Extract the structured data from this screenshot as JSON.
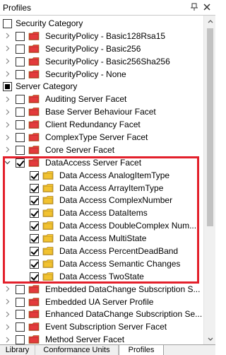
{
  "window": {
    "title": "Profiles",
    "pin_icon": "pin-icon",
    "close_icon": "close-icon"
  },
  "colors": {
    "folder_red": "#e33b3b",
    "folder_yellow": "#f2c230",
    "highlight": "#e3202b"
  },
  "tree": {
    "rows": [
      {
        "label": "Security Category",
        "level": 0,
        "check": "unchecked",
        "folder": "none",
        "arrow": "none"
      },
      {
        "label": "SecurityPolicy - Basic128Rsa15",
        "level": 1,
        "check": "unchecked",
        "folder": "red",
        "arrow": "collapsed"
      },
      {
        "label": "SecurityPolicy - Basic256",
        "level": 1,
        "check": "unchecked",
        "folder": "red",
        "arrow": "collapsed"
      },
      {
        "label": "SecurityPolicy - Basic256Sha256",
        "level": 1,
        "check": "unchecked",
        "folder": "red",
        "arrow": "collapsed"
      },
      {
        "label": "SecurityPolicy - None",
        "level": 1,
        "check": "unchecked",
        "folder": "red",
        "arrow": "collapsed"
      },
      {
        "label": "Server Category",
        "level": 0,
        "check": "partial",
        "folder": "none",
        "arrow": "none"
      },
      {
        "label": "Auditing Server Facet",
        "level": 1,
        "check": "unchecked",
        "folder": "red",
        "arrow": "collapsed"
      },
      {
        "label": "Base Server Behaviour Facet",
        "level": 1,
        "check": "unchecked",
        "folder": "red",
        "arrow": "collapsed"
      },
      {
        "label": "Client Redundancy Facet",
        "level": 1,
        "check": "unchecked",
        "folder": "red",
        "arrow": "collapsed"
      },
      {
        "label": "ComplexType Server Facet",
        "level": 1,
        "check": "unchecked",
        "folder": "red",
        "arrow": "collapsed"
      },
      {
        "label": "Core Server Facet",
        "level": 1,
        "check": "unchecked",
        "folder": "red",
        "arrow": "collapsed"
      },
      {
        "label": "DataAccess Server Facet",
        "level": 1,
        "check": "checked",
        "folder": "red",
        "arrow": "expanded"
      },
      {
        "label": "Data Access AnalogItemType",
        "level": 2,
        "check": "checked",
        "folder": "yellow",
        "arrow": "none"
      },
      {
        "label": "Data Access ArrayItemType",
        "level": 2,
        "check": "checked",
        "folder": "yellow",
        "arrow": "none"
      },
      {
        "label": "Data Access ComplexNumber",
        "level": 2,
        "check": "checked",
        "folder": "yellow",
        "arrow": "none"
      },
      {
        "label": "Data Access DataItems",
        "level": 2,
        "check": "checked",
        "folder": "yellow",
        "arrow": "none"
      },
      {
        "label": "Data Access DoubleComplex Num...",
        "level": 2,
        "check": "checked",
        "folder": "yellow",
        "arrow": "none"
      },
      {
        "label": "Data Access MultiState",
        "level": 2,
        "check": "checked",
        "folder": "yellow",
        "arrow": "none"
      },
      {
        "label": "Data Access PercentDeadBand",
        "level": 2,
        "check": "checked",
        "folder": "yellow",
        "arrow": "none"
      },
      {
        "label": "Data Access Semantic Changes",
        "level": 2,
        "check": "checked",
        "folder": "yellow",
        "arrow": "none"
      },
      {
        "label": "Data Access TwoState",
        "level": 2,
        "check": "checked",
        "folder": "yellow",
        "arrow": "none"
      },
      {
        "label": "Embedded DataChange Subscription S...",
        "level": 1,
        "check": "unchecked",
        "folder": "red",
        "arrow": "collapsed"
      },
      {
        "label": "Embedded UA Server Profile",
        "level": 1,
        "check": "unchecked",
        "folder": "red",
        "arrow": "collapsed"
      },
      {
        "label": "Enhanced DataChange Subscription Se...",
        "level": 1,
        "check": "unchecked",
        "folder": "red",
        "arrow": "collapsed"
      },
      {
        "label": "Event Subscription Server Facet",
        "level": 1,
        "check": "unchecked",
        "folder": "red",
        "arrow": "collapsed"
      },
      {
        "label": "Method Server Facet",
        "level": 1,
        "check": "unchecked",
        "folder": "red",
        "arrow": "collapsed"
      }
    ]
  },
  "tabs": [
    {
      "label": "Library",
      "active": false
    },
    {
      "label": "Conformance Units",
      "active": false
    },
    {
      "label": "Profiles",
      "active": true
    }
  ]
}
